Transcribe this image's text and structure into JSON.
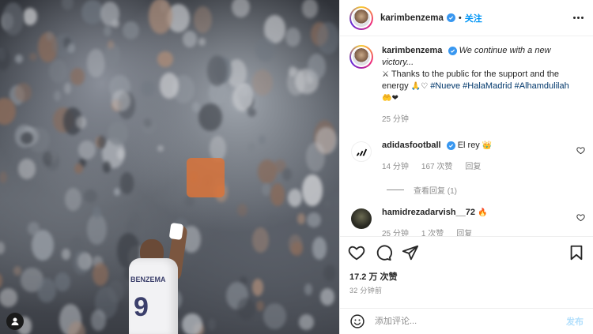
{
  "header": {
    "username": "karimbenzema",
    "follow_label": "关注",
    "separator": "•"
  },
  "caption": {
    "username": "karimbenzema",
    "line1": "We continue with a new victory...",
    "line2_emoji": "⚔",
    "line2": "Thanks to the public for the support and the energy",
    "line2_end_emoji": "🙏♡",
    "hashtags": [
      "#Nueve",
      "#HalaMadrid",
      "#Alhamdulilah"
    ],
    "trailing_emoji": "🤲❤",
    "time": "25 分钟"
  },
  "comments": [
    {
      "username": "adidasfootball",
      "text": "El rey",
      "emoji": "👑",
      "time": "14 分钟",
      "likes": "167 次赞",
      "reply_label": "回复",
      "view_replies": "查看回复 (1)"
    },
    {
      "username": "hamidrezadarvish__72",
      "emoji": "🔥",
      "time": "25 分钟",
      "likes": "1 次赞",
      "reply_label": "回复"
    }
  ],
  "post": {
    "likes": "17.2 万 次赞",
    "posted": "32 分钟前"
  },
  "compose": {
    "placeholder": "添加评论...",
    "post_label": "发布"
  },
  "photo": {
    "jersey_name": "BENZEMA",
    "jersey_number": "9"
  },
  "colors": {
    "accent": "#0095f6",
    "tag": "#00376b",
    "heart": "#ed4956",
    "muted": "#8e8e8e"
  }
}
